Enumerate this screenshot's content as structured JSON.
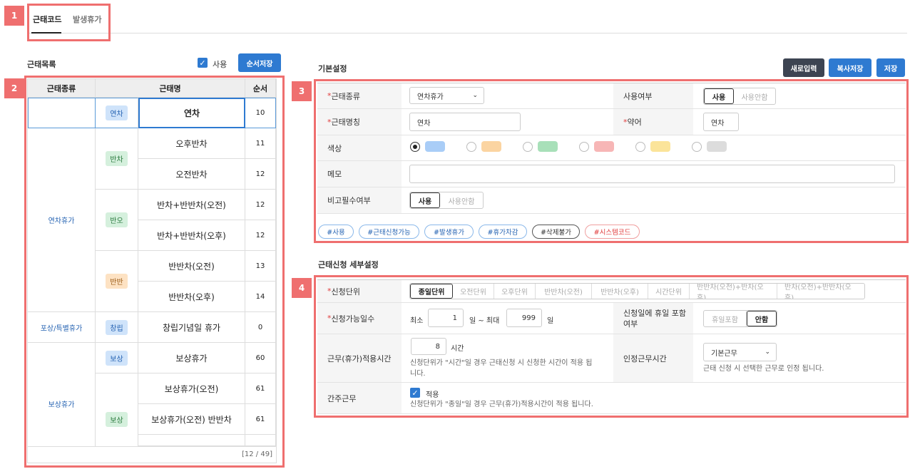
{
  "markers": [
    "1",
    "2",
    "3",
    "4"
  ],
  "tabs": [
    {
      "label": "근태코드"
    },
    {
      "label": "발생휴가"
    }
  ],
  "left": {
    "title": "근태목록",
    "use_label": "사용",
    "order_save": "순서저장",
    "columns": [
      "근태종류",
      "근태명",
      "순서"
    ],
    "groups": [
      "연차휴가",
      "포상/특별휴가",
      "보상휴가"
    ],
    "badges": [
      "연차",
      "반차",
      "반오",
      "반반",
      "창립",
      "보상",
      "보상"
    ],
    "rows": [
      {
        "name": "연차",
        "order": "10"
      },
      {
        "name": "오후반차",
        "order": "11"
      },
      {
        "name": "오전반차",
        "order": "12"
      },
      {
        "name": "반차+반반차(오전)",
        "order": "12"
      },
      {
        "name": "반차+반반차(오후)",
        "order": "12"
      },
      {
        "name": "반반차(오전)",
        "order": "13"
      },
      {
        "name": "반반차(오후)",
        "order": "14"
      },
      {
        "name": "창립기념일 휴가",
        "order": "0"
      },
      {
        "name": "보상휴가",
        "order": "60"
      },
      {
        "name": "보상휴가(오전)",
        "order": "61"
      },
      {
        "name": "보상휴가(오전) 반반차",
        "order": "61"
      }
    ],
    "count": "[12 / 49]"
  },
  "basic": {
    "title": "기본설정",
    "btn_new": "새로입력",
    "btn_copy": "복사저장",
    "btn_save": "저장",
    "type_label": "근태종류",
    "type_value": "연차휴가",
    "use_label": "사용여부",
    "use_on": "사용",
    "use_off": "사용안함",
    "name_label": "근태명칭",
    "name_value": "연차",
    "abbr_label": "약어",
    "abbr_value": "연차",
    "color_label": "색상",
    "colors": [
      "#a9cdf7",
      "#fbd4a1",
      "#a8e0b9",
      "#f7b6b6",
      "#fbe49a",
      "#dcdcdc"
    ],
    "memo_label": "메모",
    "remark_label": "비고필수여부",
    "remark_on": "사용",
    "remark_off": "사용안함",
    "tags": [
      "#사용",
      "#근태신청가능",
      "#발생휴가",
      "#휴가차감",
      "#삭제불가",
      "#시스템코드"
    ]
  },
  "detail": {
    "title": "근태신청 세부설정",
    "unit_label": "신청단위",
    "units": [
      "종일단위",
      "오전단위",
      "오후단위",
      "반반차(오전)",
      "반반차(오후)",
      "시간단위",
      "반반차(오전)+반차(오후)",
      "반차(오전)+반반차(오후)"
    ],
    "days_label": "신청가능일수",
    "min_label": "최소",
    "min_value": "1",
    "day_unit": "일",
    "max_label": "일 ~ 최대",
    "max_value": "999",
    "holiday_label_1": "신청일에 휴일 포함",
    "holiday_label_2": "여부",
    "holiday_on": "휴일포함",
    "holiday_off": "안함",
    "time_label": "근무(휴가)적용시간",
    "time_value": "8",
    "time_unit": "시간",
    "time_note_1": "신청단위가 \"시간\"일 경우 근태신청 시 신청한 시간이 적용 됩",
    "time_note_2": "니다.",
    "recog_label": "인정근무시간",
    "recog_value": "기본근무",
    "recog_note": "근태 신청 시 선택한 근무로 인정 됩니다.",
    "deem_label": "간주근무",
    "deem_check": "적용",
    "deem_note": "신청단위가 \"종일\"일 경우 근무(휴가)적용시간이 적용 됩니다."
  }
}
